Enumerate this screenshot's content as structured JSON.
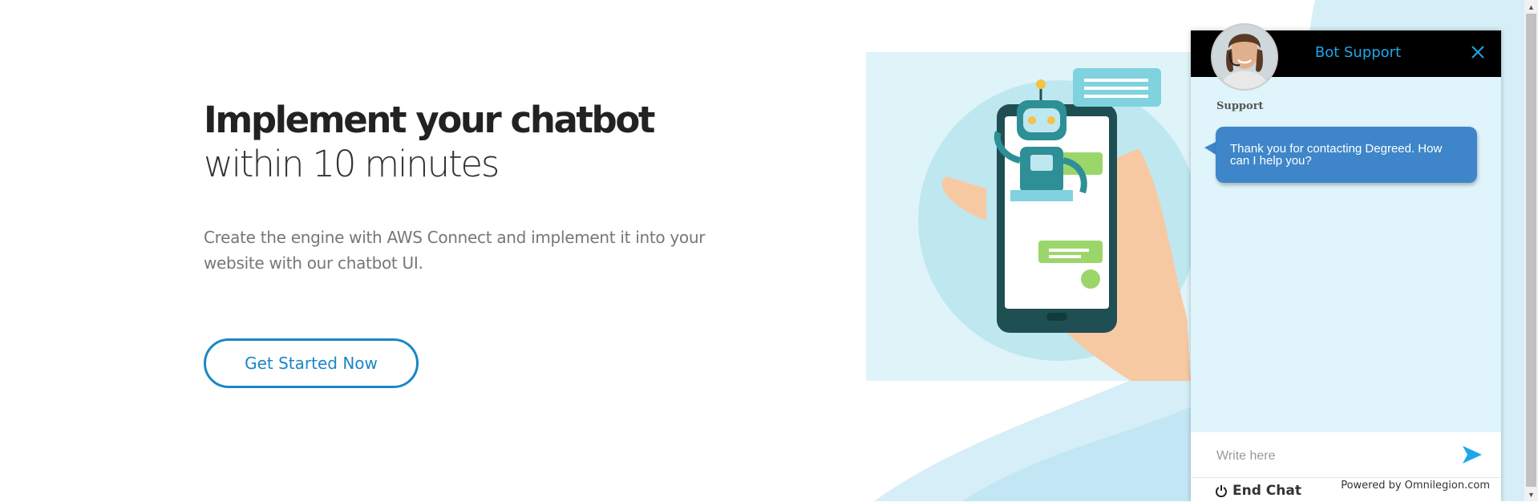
{
  "hero": {
    "title_bold": "Implement your chatbot",
    "title_light": "within 10 minutes",
    "subtitle": "Create the engine with AWS Connect and implement it into your website with our chatbot UI.",
    "cta_label": "Get Started Now"
  },
  "chat": {
    "title": "Bot Support",
    "sender": "Support",
    "message": "Thank you for contacting Degreed. How can I help you?",
    "input_placeholder": "Write here",
    "end_chat_label": "End Chat",
    "powered_by": "Powered by Omnilegion.com",
    "colors": {
      "header": "#000000",
      "title": "#1ea7e8",
      "bubble": "#3e86c9",
      "panel": "#dff4fb"
    }
  },
  "icons": [
    "close-icon",
    "send-icon",
    "power-icon",
    "robot-illustration",
    "agent-avatar"
  ],
  "colors": {
    "accent": "#1a86c7"
  }
}
